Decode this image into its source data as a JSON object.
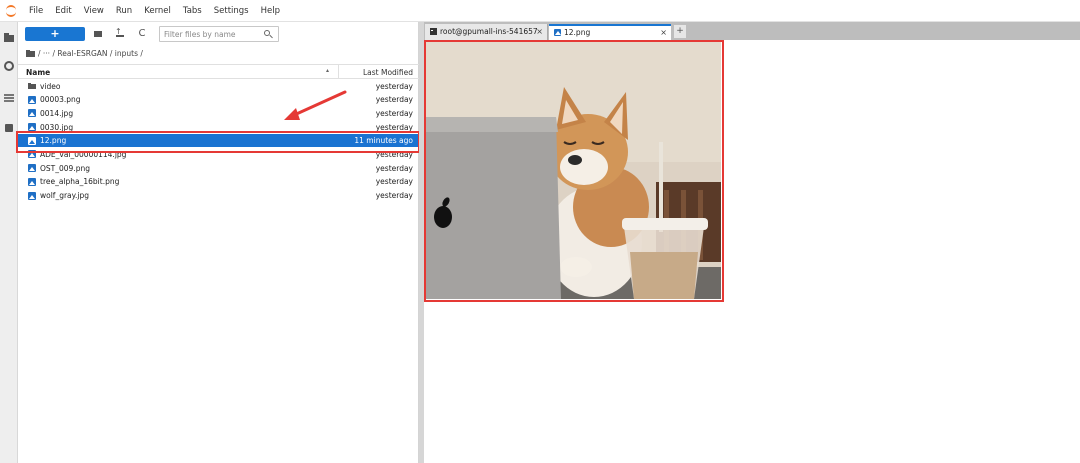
{
  "menubar": {
    "items": [
      "File",
      "Edit",
      "View",
      "Run",
      "Kernel",
      "Tabs",
      "Settings",
      "Help"
    ]
  },
  "file_browser": {
    "new_button_label": "+",
    "refresh_glyph": "C",
    "filter_placeholder": "Filter files by name",
    "breadcrumb": "/ ··· / Real-ESRGAN / inputs /",
    "columns": {
      "name": "Name",
      "sort_indicator": "▴",
      "modified": "Last Modified"
    },
    "rows": [
      {
        "name": "video",
        "modified": "yesterday",
        "icon": "folder-icon"
      },
      {
        "name": "00003.png",
        "modified": "yesterday",
        "icon": "image-file-icon"
      },
      {
        "name": "0014.jpg",
        "modified": "yesterday",
        "icon": "image-file-icon"
      },
      {
        "name": "0030.jpg",
        "modified": "yesterday",
        "icon": "image-file-icon"
      },
      {
        "name": "12.png",
        "modified": "11 minutes ago",
        "icon": "image-file-icon",
        "selected": true
      },
      {
        "name": "ADE_val_00000114.jpg",
        "modified": "yesterday",
        "icon": "image-file-icon"
      },
      {
        "name": "OST_009.png",
        "modified": "yesterday",
        "icon": "image-file-icon"
      },
      {
        "name": "tree_alpha_16bit.png",
        "modified": "yesterday",
        "icon": "image-file-icon"
      },
      {
        "name": "wolf_gray.jpg",
        "modified": "yesterday",
        "icon": "image-file-icon"
      }
    ]
  },
  "tabs": [
    {
      "label": "root@gpumall-ins-541657",
      "icon": "terminal-icon",
      "close": "×"
    },
    {
      "label": "12.png",
      "icon": "image-file-icon",
      "close": "×",
      "active": true
    }
  ],
  "tab_add": "+",
  "colors": {
    "accent": "#1976d2",
    "selection": "#1a73d1",
    "annotation": "#e53935",
    "jupyter_orange": "#f37726"
  }
}
